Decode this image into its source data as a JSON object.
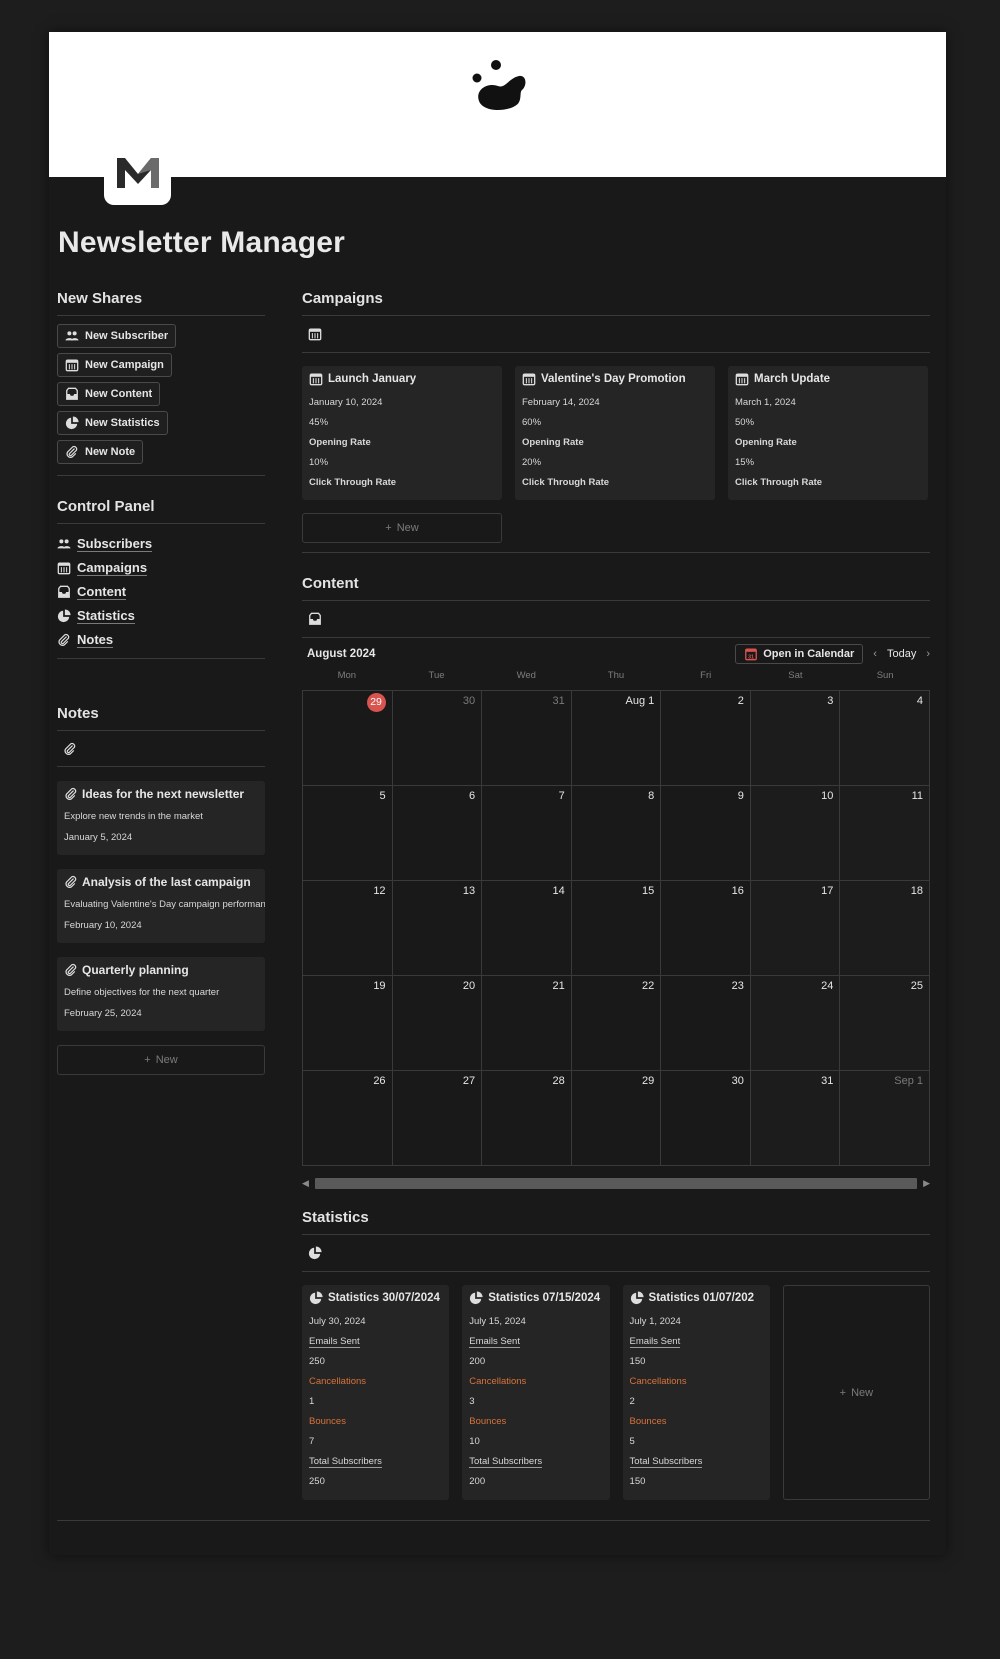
{
  "page": {
    "title": "Newsletter Manager",
    "icon_letter": "M"
  },
  "new_shares": {
    "heading": "New Shares",
    "buttons": [
      {
        "label": "New Subscriber",
        "icon": "people-icon"
      },
      {
        "label": "New Campaign",
        "icon": "calendar-icon"
      },
      {
        "label": "New Content",
        "icon": "inbox-icon"
      },
      {
        "label": "New Statistics",
        "icon": "pie-chart-icon"
      },
      {
        "label": "New Note",
        "icon": "paperclip-icon"
      }
    ]
  },
  "control_panel": {
    "heading": "Control Panel",
    "items": [
      {
        "label": "Subscribers",
        "icon": "people-icon"
      },
      {
        "label": "Campaigns",
        "icon": "calendar-icon"
      },
      {
        "label": "Content",
        "icon": "inbox-icon"
      },
      {
        "label": "Statistics",
        "icon": "pie-chart-icon"
      },
      {
        "label": "Notes",
        "icon": "paperclip-icon"
      }
    ]
  },
  "notes": {
    "heading": "Notes",
    "new_label": "New",
    "cards": [
      {
        "title": "Ideas for the next newsletter",
        "desc": "Explore new trends in the market",
        "date": "January 5, 2024"
      },
      {
        "title": "Analysis of the last campaign",
        "desc": "Evaluating Valentine's Day campaign performance",
        "date": "February 10, 2024"
      },
      {
        "title": "Quarterly planning",
        "desc": "Define objectives for the next quarter",
        "date": "February 25, 2024"
      }
    ]
  },
  "campaigns": {
    "heading": "Campaigns",
    "new_label": "New",
    "cards": [
      {
        "title": "Launch January",
        "date": "January 10, 2024",
        "open_rate": "45%",
        "open_label": "Opening Rate",
        "ctr": "10%",
        "ctr_label": "Click Through Rate"
      },
      {
        "title": "Valentine's Day Promotion",
        "date": "February 14, 2024",
        "open_rate": "60%",
        "open_label": "Opening Rate",
        "ctr": "20%",
        "ctr_label": "Click Through Rate"
      },
      {
        "title": "March Update",
        "date": "March 1, 2024",
        "open_rate": "50%",
        "open_label": "Opening Rate",
        "ctr": "15%",
        "ctr_label": "Click Through Rate"
      }
    ]
  },
  "content": {
    "heading": "Content",
    "calendar": {
      "month": "August 2024",
      "open_label": "Open in Calendar",
      "today_label": "Today",
      "weekdays": [
        "Mon",
        "Tue",
        "Wed",
        "Thu",
        "Fri",
        "Sat",
        "Sun"
      ],
      "days": [
        "29",
        "30",
        "31",
        "Aug 1",
        "2",
        "3",
        "4",
        "5",
        "6",
        "7",
        "8",
        "9",
        "10",
        "11",
        "12",
        "13",
        "14",
        "15",
        "16",
        "17",
        "18",
        "19",
        "20",
        "21",
        "22",
        "23",
        "24",
        "25",
        "26",
        "27",
        "28",
        "29",
        "30",
        "31",
        "Sep 1"
      ],
      "today_index": 0,
      "muted_indices": [
        1,
        2,
        34
      ]
    }
  },
  "statistics": {
    "heading": "Statistics",
    "new_label": "New",
    "cards": [
      {
        "title": "Statistics 30/07/2024",
        "date": "July 30, 2024",
        "sent_label": "Emails Sent",
        "sent": "250",
        "cancel_label": "Cancellations",
        "cancel": "1",
        "bounce_label": "Bounces",
        "bounce": "7",
        "total_label": "Total Subscribers",
        "total": "250"
      },
      {
        "title": "Statistics 07/15/2024",
        "date": "July 15, 2024",
        "sent_label": "Emails Sent",
        "sent": "200",
        "cancel_label": "Cancellations",
        "cancel": "3",
        "bounce_label": "Bounces",
        "bounce": "10",
        "total_label": "Total Subscribers",
        "total": "200"
      },
      {
        "title": "Statistics 01/07/202",
        "date": "July 1, 2024",
        "sent_label": "Emails Sent",
        "sent": "150",
        "cancel_label": "Cancellations",
        "cancel": "2",
        "bounce_label": "Bounces",
        "bounce": "5",
        "total_label": "Total Subscribers",
        "total": "150"
      }
    ]
  },
  "colors": {
    "background": "#191919",
    "card": "#252525",
    "accent_orange": "#d9733a",
    "today_red": "#d9534f"
  }
}
